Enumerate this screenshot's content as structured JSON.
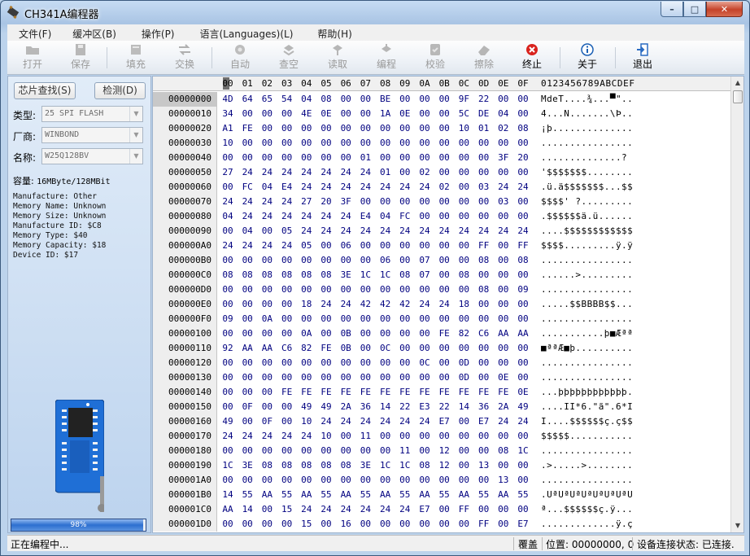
{
  "window": {
    "title": "CH341A编程器",
    "min": "–",
    "max": "□",
    "close": "✕"
  },
  "menu": [
    "文件(F)",
    "缓冲区(B)",
    "操作(P)",
    "语言(Languages)(L)",
    "帮助(H)"
  ],
  "toolbar": [
    {
      "label": "打开",
      "icon": "open-icon",
      "enabled": false
    },
    {
      "label": "保存",
      "icon": "save-icon",
      "enabled": false
    },
    {
      "label": "填充",
      "icon": "fill-icon",
      "enabled": false
    },
    {
      "label": "交换",
      "icon": "swap-icon",
      "enabled": false
    },
    {
      "label": "自动",
      "icon": "auto-icon",
      "enabled": false
    },
    {
      "label": "查空",
      "icon": "blank-check-icon",
      "enabled": false
    },
    {
      "label": "读取",
      "icon": "read-icon",
      "enabled": false
    },
    {
      "label": "编程",
      "icon": "program-icon",
      "enabled": false
    },
    {
      "label": "校验",
      "icon": "verify-icon",
      "enabled": false
    },
    {
      "label": "擦除",
      "icon": "erase-icon",
      "enabled": false
    },
    {
      "label": "终止",
      "icon": "stop-icon",
      "enabled": true
    },
    {
      "label": "关于",
      "icon": "info-icon",
      "enabled": true
    },
    {
      "label": "退出",
      "icon": "exit-icon",
      "enabled": true
    }
  ],
  "left": {
    "detect_button": "芯片查找(S)",
    "check_button": "检测(D)",
    "type_label": "类型:",
    "type_value": "25 SPI FLASH",
    "vendor_label": "厂商:",
    "vendor_value": "WINBOND",
    "name_label": "名称:",
    "name_value": "W25Q128BV",
    "capacity_label": "容量:",
    "capacity_value": "16MByte/128MBit",
    "info": [
      "Manufacture: Other",
      "Memory Name: Unknown",
      "Memory Size: Unknown",
      "Manufacture ID: $C8",
      "Memory Type: $40",
      "Memory Capacity: $18",
      "Device ID: $17"
    ],
    "progress": 0.98,
    "progress_label": "98%"
  },
  "hex": {
    "columns": [
      "0",
      "1",
      "2",
      "3",
      "4",
      "5",
      "6",
      "7",
      "8",
      "9",
      "0A",
      "0B",
      "0C",
      "0D",
      "0E",
      "0F"
    ],
    "column_display": [
      "00",
      "01",
      "02",
      "03",
      "04",
      "05",
      "06",
      "07",
      "08",
      "09",
      "0A",
      "0B",
      "0C",
      "0D",
      "0E",
      "0F"
    ],
    "ascii_header": "0123456789ABCDEF",
    "rows": [
      {
        "addr": "00000000",
        "bytes": "4D 64 65 54 04 08 00 00 BE 00 00 00 9F 22 00 00",
        "ascii": "MdeT....¾...▀\"..",
        "selected": true
      },
      {
        "addr": "00000010",
        "bytes": "34 00 00 00 4E 0E 00 00 1A 0E 00 00 5C DE 04 00",
        "ascii": "4...N.......\\Þ..",
        "selected": false
      },
      {
        "addr": "00000020",
        "bytes": "A1 FE 00 00 00 00 00 00 00 00 00 00 10 01 02 08",
        "ascii": "¡þ..............",
        "selected": false
      },
      {
        "addr": "00000030",
        "bytes": "10 00 00 00 00 00 00 00 00 00 00 00 00 00 00 00",
        "ascii": "................",
        "selected": false
      },
      {
        "addr": "00000040",
        "bytes": "00 00 00 00 00 00 00 01 00 00 00 00 00 00 3F 20",
        "ascii": "..............? ",
        "selected": false
      },
      {
        "addr": "00000050",
        "bytes": "27 24 24 24 24 24 24 24 01 00 02 00 00 00 00 00",
        "ascii": "'$$$$$$$........",
        "selected": false
      },
      {
        "addr": "00000060",
        "bytes": "00 FC 04 E4 24 24 24 24 24 24 24 02 00 03 24 24",
        "ascii": ".ü.ä$$$$$$$...$$",
        "selected": false
      },
      {
        "addr": "00000070",
        "bytes": "24 24 24 24 27 20 3F 00 00 00 00 00 00 00 03 00",
        "ascii": "$$$$' ?.........",
        "selected": false
      },
      {
        "addr": "00000080",
        "bytes": "04 24 24 24 24 24 24 E4 04 FC 00 00 00 00 00 00",
        "ascii": ".$$$$$$ä.ü......",
        "selected": false
      },
      {
        "addr": "00000090",
        "bytes": "00 04 00 05 24 24 24 24 24 24 24 24 24 24 24 24",
        "ascii": "....$$$$$$$$$$$$",
        "selected": false
      },
      {
        "addr": "000000A0",
        "bytes": "24 24 24 24 05 00 06 00 00 00 00 00 00 FF 00 FF",
        "ascii": "$$$$.........ÿ.ÿ",
        "selected": false
      },
      {
        "addr": "000000B0",
        "bytes": "00 00 00 00 00 00 00 00 06 00 07 00 00 08 00 08",
        "ascii": "................",
        "selected": false
      },
      {
        "addr": "000000C0",
        "bytes": "08 08 08 08 08 08 3E 1C 1C 08 07 00 08 00 00 00",
        "ascii": "......>.........",
        "selected": false
      },
      {
        "addr": "000000D0",
        "bytes": "00 00 00 00 00 00 00 00 00 00 00 00 00 08 00 09",
        "ascii": "................",
        "selected": false
      },
      {
        "addr": "000000E0",
        "bytes": "00 00 00 00 18 24 24 42 42 42 24 24 18 00 00 00",
        "ascii": ".....$$BBBB$$...",
        "selected": false
      },
      {
        "addr": "000000F0",
        "bytes": "09 00 0A 00 00 00 00 00 00 00 00 00 00 00 00 00",
        "ascii": "................",
        "selected": false
      },
      {
        "addr": "00000100",
        "bytes": "00 00 00 00 0A 00 0B 00 00 00 00 FE 82 C6 AA AA",
        "ascii": "...........þ■Æªª",
        "selected": false
      },
      {
        "addr": "00000110",
        "bytes": "92 AA AA C6 82 FE 0B 00 0C 00 00 00 00 00 00 00",
        "ascii": "■ªªÆ■þ..........",
        "selected": false
      },
      {
        "addr": "00000120",
        "bytes": "00 00 00 00 00 00 00 00 00 00 0C 00 0D 00 00 00",
        "ascii": "................",
        "selected": false
      },
      {
        "addr": "00000130",
        "bytes": "00 00 00 00 00 00 00 00 00 00 00 00 0D 00 0E 00",
        "ascii": "................",
        "selected": false
      },
      {
        "addr": "00000140",
        "bytes": "00 00 00 FE FE FE FE FE FE FE FE FE FE FE FE 0E",
        "ascii": "...þþþþþþþþþþþþ.",
        "selected": false
      },
      {
        "addr": "00000150",
        "bytes": "00 0F 00 00 49 49 2A 36 14 22 E3 22 14 36 2A 49",
        "ascii": "....II*6.\"ã\".6*I",
        "selected": false
      },
      {
        "addr": "00000160",
        "bytes": "49 00 0F 00 10 24 24 24 24 24 24 E7 00 E7 24 24",
        "ascii": "I....$$$$$$ç.ç$$",
        "selected": false
      },
      {
        "addr": "00000170",
        "bytes": "24 24 24 24 24 10 00 11 00 00 00 00 00 00 00 00",
        "ascii": "$$$$$...........",
        "selected": false
      },
      {
        "addr": "00000180",
        "bytes": "00 00 00 00 00 00 00 00 00 11 00 12 00 00 08 1C",
        "ascii": "................",
        "selected": false
      },
      {
        "addr": "00000190",
        "bytes": "1C 3E 08 08 08 08 08 3E 1C 1C 08 12 00 13 00 00",
        "ascii": ".>.....>........",
        "selected": false
      },
      {
        "addr": "000001A0",
        "bytes": "00 00 00 00 00 00 00 00 00 00 00 00 00 00 13 00",
        "ascii": "................",
        "selected": false
      },
      {
        "addr": "000001B0",
        "bytes": "14 55 AA 55 AA 55 AA 55 AA 55 AA 55 AA 55 AA 55",
        "ascii": ".UªUªUªUªUªUªUªU",
        "selected": false
      },
      {
        "addr": "000001C0",
        "bytes": "AA 14 00 15 24 24 24 24 24 24 E7 00 FF 00 00 00",
        "ascii": "ª...$$$$$$ç.ÿ...",
        "selected": false
      },
      {
        "addr": "000001D0",
        "bytes": "00 00 00 00 15 00 16 00 00 00 00 00 00 FF 00 E7",
        "ascii": ".............ÿ.ç",
        "selected": false
      }
    ]
  },
  "status": {
    "state": "正在编程中...",
    "mode": "覆盖",
    "position": "位置: 00000000, 0",
    "device": "设备连接状态: 已连接."
  }
}
